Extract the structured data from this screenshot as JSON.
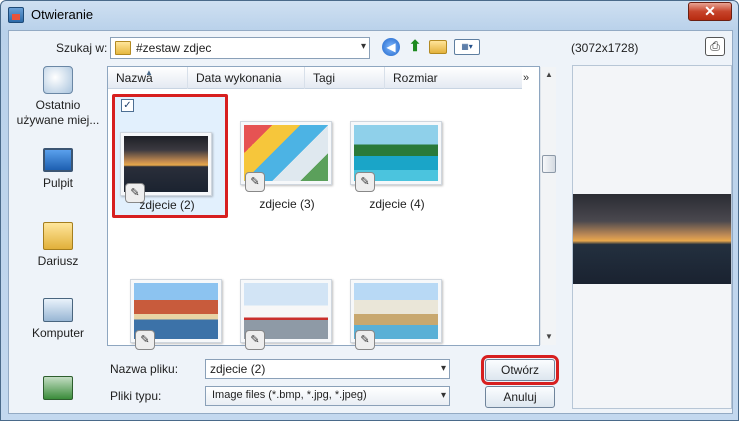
{
  "window": {
    "title": "Otwieranie",
    "close_glyph": "✕"
  },
  "toolbar": {
    "lookin_label": "Szukaj w:",
    "lookin_value": "#zestaw zdjec",
    "combo_arrow": "▾",
    "back_glyph": "◀",
    "up_glyph": "⬆",
    "view_glyph": "▦▾"
  },
  "resolution": "(3072x1728)",
  "preview_btn_glyph": "⎙",
  "places": [
    {
      "label": "Ostatnio używane miej...",
      "icon": "recent-places-icon"
    },
    {
      "label": "Pulpit",
      "icon": "desktop-icon"
    },
    {
      "label": "Dariusz",
      "icon": "user-folder-icon"
    },
    {
      "label": "Komputer",
      "icon": "computer-icon"
    },
    {
      "label": "",
      "icon": "network-icon"
    }
  ],
  "columns": [
    "Nazwa",
    "Data wykonania",
    "Tagi",
    "Rozmiar"
  ],
  "columns_more": "»",
  "sort_glyph": "▲",
  "scroll_up": "▲",
  "scroll_down": "▼",
  "thumbs": [
    {
      "label": "zdjecie (2)",
      "selected": true,
      "check": "✓",
      "badge": "✎"
    },
    {
      "label": "zdjecie (3)",
      "badge": "✎"
    },
    {
      "label": "zdjecie (4)",
      "badge": "✎"
    },
    {
      "label": "",
      "badge": "✎"
    },
    {
      "label": "",
      "badge": "✎"
    },
    {
      "label": "",
      "badge": "✎"
    }
  ],
  "filename": {
    "label": "Nazwa pliku:",
    "value": "zdjecie (2)",
    "arrow": "▾"
  },
  "filetype": {
    "label": "Pliki typu:",
    "value": "Image files (*.bmp, *.jpg, *.jpeg)",
    "arrow": "▾"
  },
  "buttons": {
    "open": "Otwórz",
    "cancel": "Anuluj"
  }
}
